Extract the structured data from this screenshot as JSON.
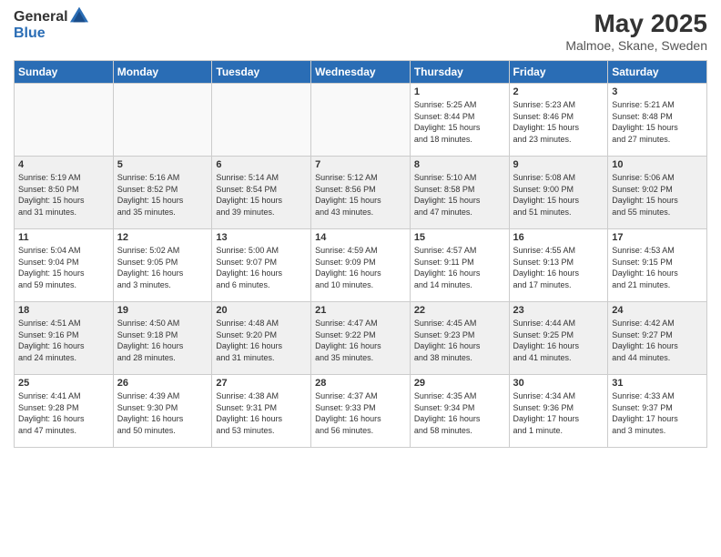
{
  "logo": {
    "general": "General",
    "blue": "Blue"
  },
  "header": {
    "month": "May 2025",
    "location": "Malmoe, Skane, Sweden"
  },
  "weekdays": [
    "Sunday",
    "Monday",
    "Tuesday",
    "Wednesday",
    "Thursday",
    "Friday",
    "Saturday"
  ],
  "weeks": [
    [
      {
        "day": "",
        "info": "",
        "empty": true
      },
      {
        "day": "",
        "info": "",
        "empty": true
      },
      {
        "day": "",
        "info": "",
        "empty": true
      },
      {
        "day": "",
        "info": "",
        "empty": true
      },
      {
        "day": "1",
        "info": "Sunrise: 5:25 AM\nSunset: 8:44 PM\nDaylight: 15 hours\nand 18 minutes."
      },
      {
        "day": "2",
        "info": "Sunrise: 5:23 AM\nSunset: 8:46 PM\nDaylight: 15 hours\nand 23 minutes."
      },
      {
        "day": "3",
        "info": "Sunrise: 5:21 AM\nSunset: 8:48 PM\nDaylight: 15 hours\nand 27 minutes."
      }
    ],
    [
      {
        "day": "4",
        "info": "Sunrise: 5:19 AM\nSunset: 8:50 PM\nDaylight: 15 hours\nand 31 minutes."
      },
      {
        "day": "5",
        "info": "Sunrise: 5:16 AM\nSunset: 8:52 PM\nDaylight: 15 hours\nand 35 minutes."
      },
      {
        "day": "6",
        "info": "Sunrise: 5:14 AM\nSunset: 8:54 PM\nDaylight: 15 hours\nand 39 minutes."
      },
      {
        "day": "7",
        "info": "Sunrise: 5:12 AM\nSunset: 8:56 PM\nDaylight: 15 hours\nand 43 minutes."
      },
      {
        "day": "8",
        "info": "Sunrise: 5:10 AM\nSunset: 8:58 PM\nDaylight: 15 hours\nand 47 minutes."
      },
      {
        "day": "9",
        "info": "Sunrise: 5:08 AM\nSunset: 9:00 PM\nDaylight: 15 hours\nand 51 minutes."
      },
      {
        "day": "10",
        "info": "Sunrise: 5:06 AM\nSunset: 9:02 PM\nDaylight: 15 hours\nand 55 minutes."
      }
    ],
    [
      {
        "day": "11",
        "info": "Sunrise: 5:04 AM\nSunset: 9:04 PM\nDaylight: 15 hours\nand 59 minutes."
      },
      {
        "day": "12",
        "info": "Sunrise: 5:02 AM\nSunset: 9:05 PM\nDaylight: 16 hours\nand 3 minutes."
      },
      {
        "day": "13",
        "info": "Sunrise: 5:00 AM\nSunset: 9:07 PM\nDaylight: 16 hours\nand 6 minutes."
      },
      {
        "day": "14",
        "info": "Sunrise: 4:59 AM\nSunset: 9:09 PM\nDaylight: 16 hours\nand 10 minutes."
      },
      {
        "day": "15",
        "info": "Sunrise: 4:57 AM\nSunset: 9:11 PM\nDaylight: 16 hours\nand 14 minutes."
      },
      {
        "day": "16",
        "info": "Sunrise: 4:55 AM\nSunset: 9:13 PM\nDaylight: 16 hours\nand 17 minutes."
      },
      {
        "day": "17",
        "info": "Sunrise: 4:53 AM\nSunset: 9:15 PM\nDaylight: 16 hours\nand 21 minutes."
      }
    ],
    [
      {
        "day": "18",
        "info": "Sunrise: 4:51 AM\nSunset: 9:16 PM\nDaylight: 16 hours\nand 24 minutes."
      },
      {
        "day": "19",
        "info": "Sunrise: 4:50 AM\nSunset: 9:18 PM\nDaylight: 16 hours\nand 28 minutes."
      },
      {
        "day": "20",
        "info": "Sunrise: 4:48 AM\nSunset: 9:20 PM\nDaylight: 16 hours\nand 31 minutes."
      },
      {
        "day": "21",
        "info": "Sunrise: 4:47 AM\nSunset: 9:22 PM\nDaylight: 16 hours\nand 35 minutes."
      },
      {
        "day": "22",
        "info": "Sunrise: 4:45 AM\nSunset: 9:23 PM\nDaylight: 16 hours\nand 38 minutes."
      },
      {
        "day": "23",
        "info": "Sunrise: 4:44 AM\nSunset: 9:25 PM\nDaylight: 16 hours\nand 41 minutes."
      },
      {
        "day": "24",
        "info": "Sunrise: 4:42 AM\nSunset: 9:27 PM\nDaylight: 16 hours\nand 44 minutes."
      }
    ],
    [
      {
        "day": "25",
        "info": "Sunrise: 4:41 AM\nSunset: 9:28 PM\nDaylight: 16 hours\nand 47 minutes."
      },
      {
        "day": "26",
        "info": "Sunrise: 4:39 AM\nSunset: 9:30 PM\nDaylight: 16 hours\nand 50 minutes."
      },
      {
        "day": "27",
        "info": "Sunrise: 4:38 AM\nSunset: 9:31 PM\nDaylight: 16 hours\nand 53 minutes."
      },
      {
        "day": "28",
        "info": "Sunrise: 4:37 AM\nSunset: 9:33 PM\nDaylight: 16 hours\nand 56 minutes."
      },
      {
        "day": "29",
        "info": "Sunrise: 4:35 AM\nSunset: 9:34 PM\nDaylight: 16 hours\nand 58 minutes."
      },
      {
        "day": "30",
        "info": "Sunrise: 4:34 AM\nSunset: 9:36 PM\nDaylight: 17 hours\nand 1 minute."
      },
      {
        "day": "31",
        "info": "Sunrise: 4:33 AM\nSunset: 9:37 PM\nDaylight: 17 hours\nand 3 minutes."
      }
    ]
  ]
}
